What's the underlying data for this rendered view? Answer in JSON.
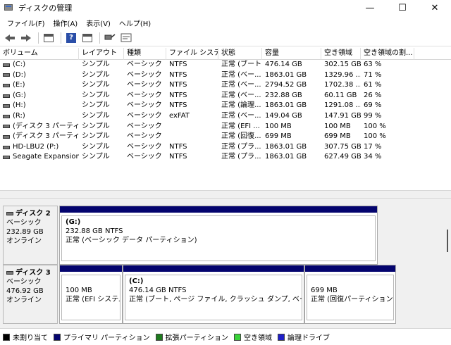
{
  "window": {
    "title": "ディスクの管理",
    "minimize": "—",
    "maximize": "☐",
    "close": "✕"
  },
  "menu": [
    "ファイル(F)",
    "操作(A)",
    "表示(V)",
    "ヘルプ(H)"
  ],
  "toolbar": {
    "icons": [
      "back-arrow-icon",
      "forward-arrow-icon",
      "view-icon",
      "help-icon",
      "properties-icon",
      "rescan-icon",
      "refresh-icon"
    ],
    "help_glyph": "?"
  },
  "table": {
    "columns": [
      "ボリューム",
      "レイアウト",
      "種類",
      "ファイル システム",
      "状態",
      "容量",
      "空き領域",
      "空き領域の割..."
    ],
    "rows": [
      [
        "(C:)",
        "シンプル",
        "ベーシック",
        "NTFS",
        "正常 (ブート...",
        "476.14 GB",
        "302.15 GB",
        "63 %"
      ],
      [
        "(D:)",
        "シンプル",
        "ベーシック",
        "NTFS",
        "正常 (ベー...",
        "1863.01 GB",
        "1329.96 ...",
        "71 %"
      ],
      [
        "(E:)",
        "シンプル",
        "ベーシック",
        "NTFS",
        "正常 (ベー...",
        "2794.52 GB",
        "1702.38 ...",
        "61 %"
      ],
      [
        "(G:)",
        "シンプル",
        "ベーシック",
        "NTFS",
        "正常 (ベー...",
        "232.88 GB",
        "60.11 GB",
        "26 %"
      ],
      [
        "(H:)",
        "シンプル",
        "ベーシック",
        "NTFS",
        "正常 (論理...",
        "1863.01 GB",
        "1291.08 ...",
        "69 %"
      ],
      [
        "(R:)",
        "シンプル",
        "ベーシック",
        "exFAT",
        "正常 (ベー...",
        "149.04 GB",
        "147.91 GB",
        "99 %"
      ],
      [
        "(ディスク 3 パーティシ...",
        "シンプル",
        "ベーシック",
        "",
        "正常 (EFI ...",
        "100 MB",
        "100 MB",
        "100 %"
      ],
      [
        "(ディスク 3 パーティシ...",
        "シンプル",
        "ベーシック",
        "",
        "正常 (回復...",
        "699 MB",
        "699 MB",
        "100 %"
      ],
      [
        "HD-LBU2 (P:)",
        "シンプル",
        "ベーシック",
        "NTFS",
        "正常 (プラ...",
        "1863.01 GB",
        "307.75 GB",
        "17 %"
      ],
      [
        "Seagate Expansion...",
        "シンプル",
        "ベーシック",
        "NTFS",
        "正常 (プラ...",
        "1863.01 GB",
        "627.49 GB",
        "34 %"
      ]
    ]
  },
  "disks": [
    {
      "name": "ディスク 2",
      "type": "ベーシック",
      "size": "232.89 GB",
      "status": "オンライン",
      "partitions": [
        {
          "letter": "(G:)",
          "size": "232.88 GB NTFS",
          "status": "正常 (ベーシック データ パーティション)"
        }
      ]
    },
    {
      "name": "ディスク 3",
      "type": "ベーシック",
      "size": "476.92 GB",
      "status": "オンライン",
      "partitions": [
        {
          "letter": "",
          "size": "100 MB",
          "status": "正常 (EFI システム"
        },
        {
          "letter": "(C:)",
          "size": "476.14 GB NTFS",
          "status": "正常 (ブート, ページ ファイル, クラッシュ ダンプ, ベーシック データ"
        },
        {
          "letter": "",
          "size": "699 MB",
          "status": "正常 (回復パーティション)"
        }
      ]
    }
  ],
  "legend": [
    {
      "label": "未割り当て",
      "color": "#000000"
    },
    {
      "label": "プライマリ パーティション",
      "color": "#04046e"
    },
    {
      "label": "拡張パーティション",
      "color": "#1e7a1e"
    },
    {
      "label": "空き領域",
      "color": "#39d339"
    },
    {
      "label": "論理ドライブ",
      "color": "#2020c8"
    }
  ]
}
